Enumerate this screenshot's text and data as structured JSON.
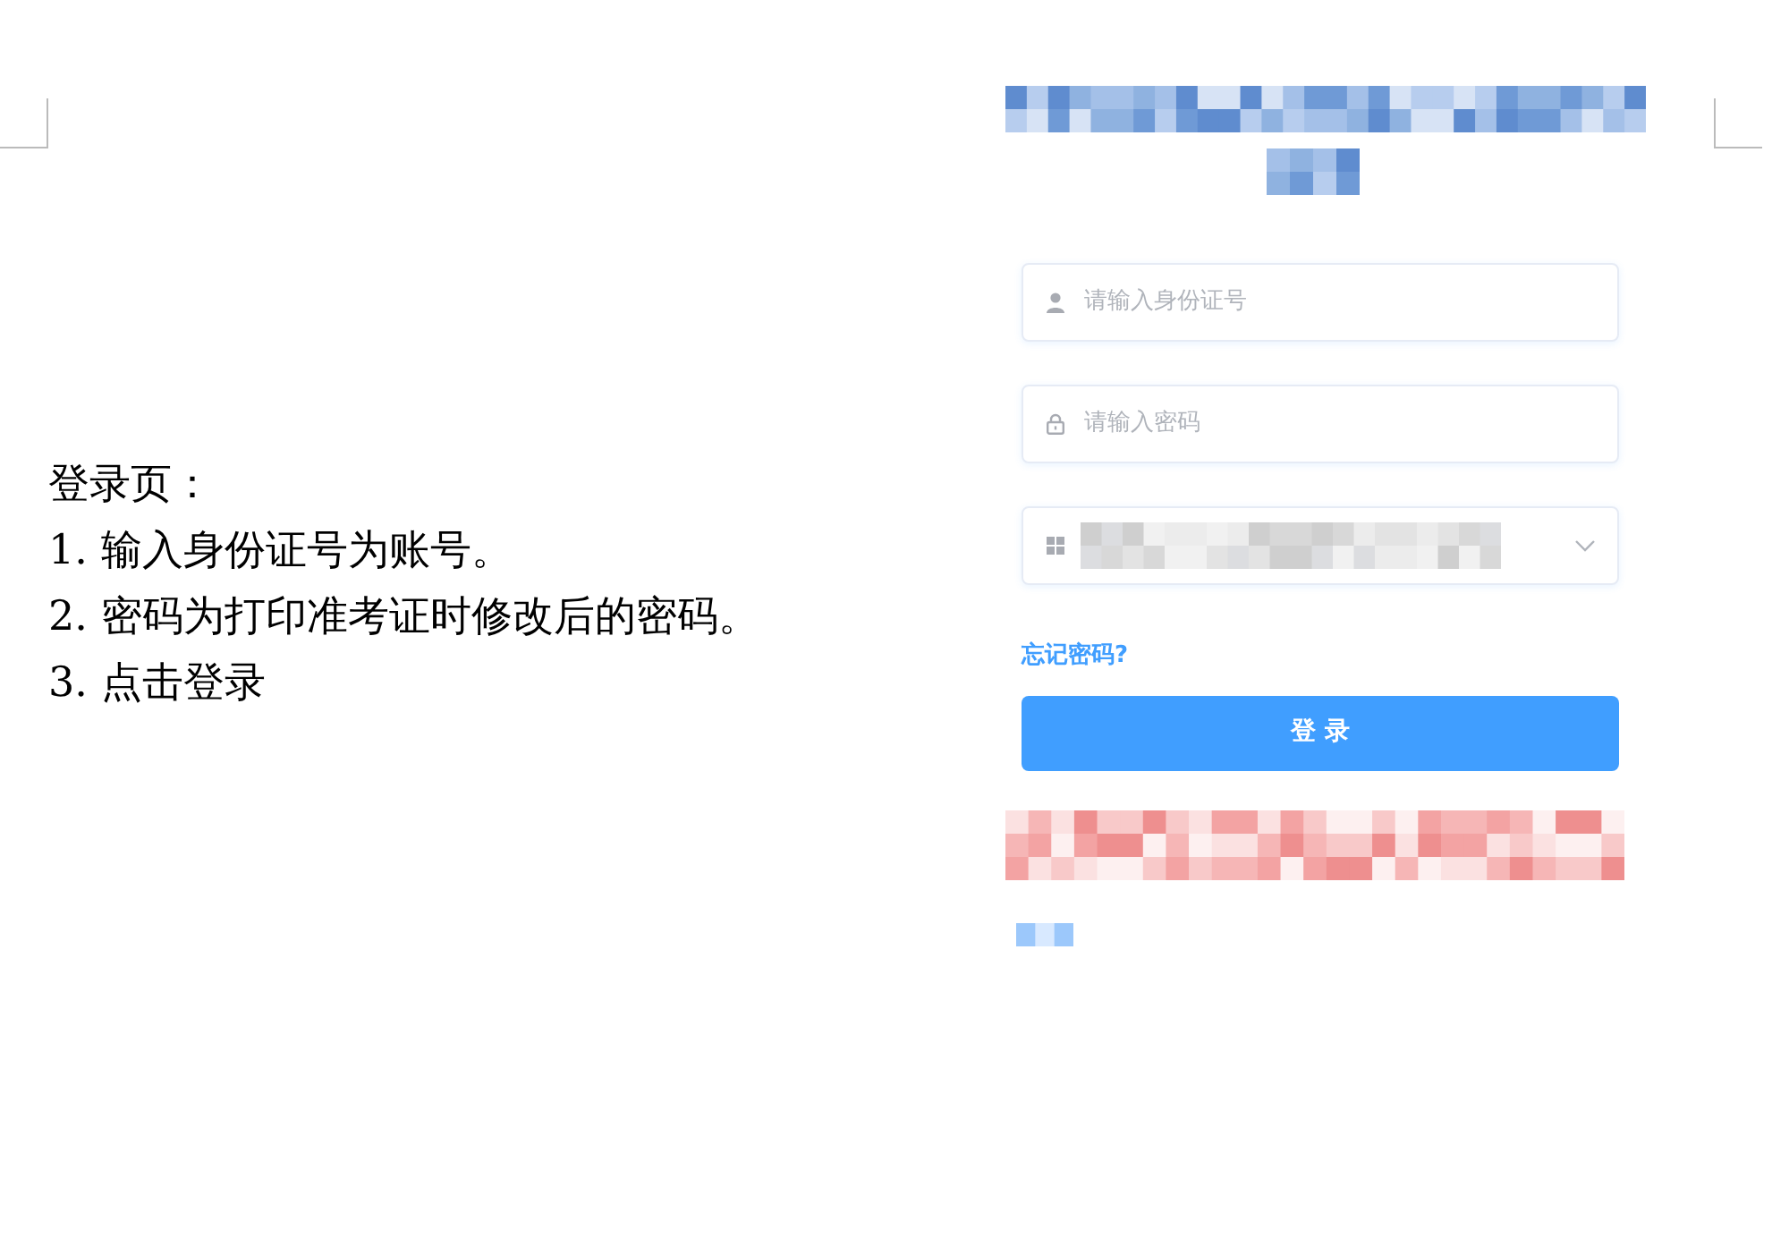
{
  "instructions": {
    "title": "登录页：",
    "steps": [
      "1. 输入身份证号为账号。",
      "2. 密码为打印准考证时修改后的密码。",
      "3. 点击登录"
    ]
  },
  "login": {
    "fields": [
      {
        "kind": "text",
        "placeholder": "请输入身份证号"
      },
      {
        "kind": "password",
        "placeholder": "请输入密码"
      },
      {
        "kind": "select"
      }
    ],
    "forgot_link": "忘记密码?",
    "submit_button": "登 录"
  }
}
